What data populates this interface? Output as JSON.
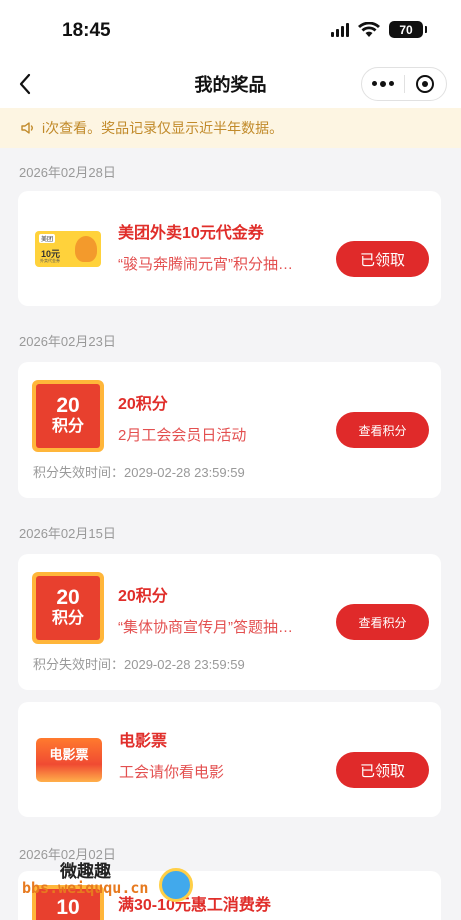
{
  "status_bar": {
    "time": "18:45",
    "battery": "70"
  },
  "nav": {
    "title": "我的奖品"
  },
  "notice": {
    "text": "i次查看。奖品记录仅显示近半年数据。"
  },
  "groups": [
    {
      "date": "2026年02月28日",
      "items": [
        {
          "name": "美团外卖10元代金券",
          "desc": "“骏马奔腾闹元宵”积分抽…",
          "button": "已领取",
          "icon": "meituan-voucher-icon",
          "voucher": {
            "tag": "美团",
            "amount": "10元",
            "sub": "外卖代金券"
          }
        }
      ]
    },
    {
      "date": "2026年02月23日",
      "items": [
        {
          "name": "20积分",
          "desc": "2月工会会员日活动",
          "button": "查看积分",
          "icon": "points-icon",
          "badge_num": "20",
          "badge_label": "积分",
          "expire": "积分失效时间：2029-02-28 23:59:59"
        }
      ]
    },
    {
      "date": "2026年02月15日",
      "items": [
        {
          "name": "20积分",
          "desc": "“集体协商宣传月”答题抽…",
          "button": "查看积分",
          "icon": "points-icon",
          "badge_num": "20",
          "badge_label": "积分",
          "expire": "积分失效时间：2029-02-28 23:59:59"
        },
        {
          "name": "电影票",
          "desc": "工会请你看电影",
          "button": "已领取",
          "icon": "movie-ticket-icon",
          "badge_label": "电影票"
        }
      ]
    },
    {
      "date": "2026年02月02日",
      "items": [
        {
          "name": "满30-10元惠工消费券",
          "icon": "points-icon",
          "badge_num": "10"
        }
      ]
    }
  ],
  "watermark": {
    "line1": "微趣趣",
    "line2": "bbs.weiququ.cn"
  },
  "colors": {
    "accent": "#e02a2a",
    "notice_bg": "#fdf5e2",
    "notice_text": "#c18a2a"
  }
}
